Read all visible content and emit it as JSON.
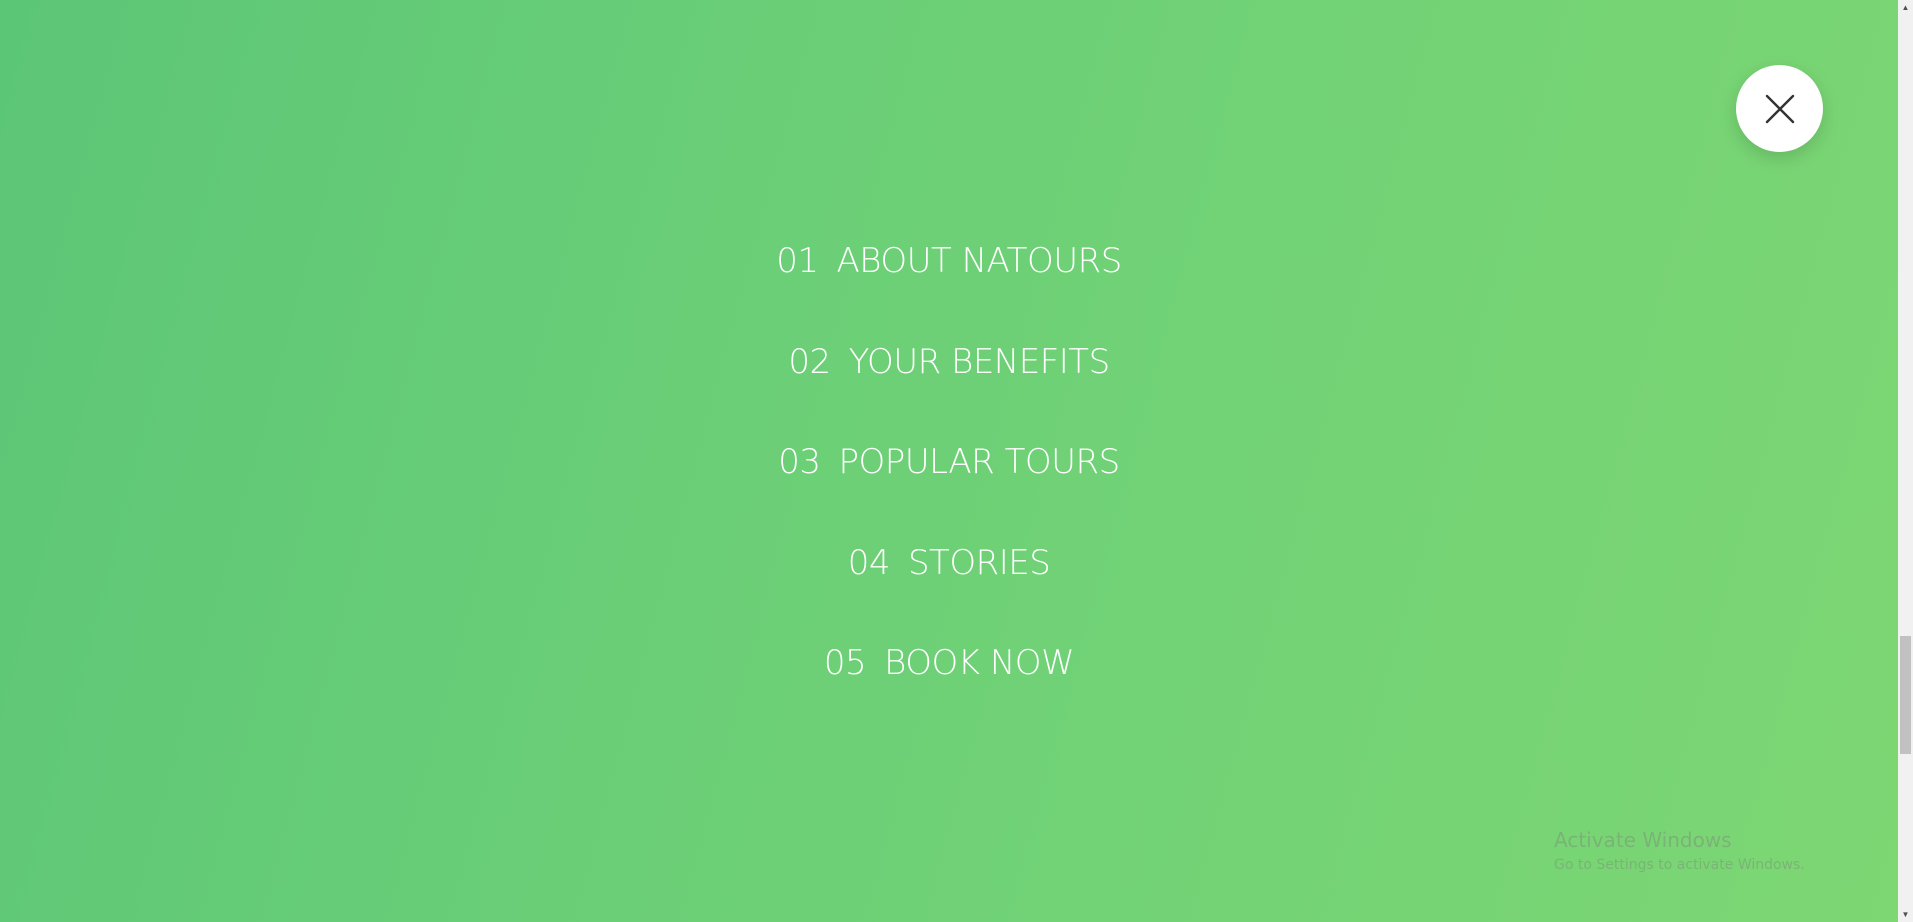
{
  "close_button": {
    "icon": "close-icon"
  },
  "navigation": {
    "items": [
      {
        "number": "01",
        "label": "ABOUT NATOURS"
      },
      {
        "number": "02",
        "label": "YOUR BENEFITS"
      },
      {
        "number": "03",
        "label": "POPULAR TOURS"
      },
      {
        "number": "04",
        "label": "STORIES"
      },
      {
        "number": "05",
        "label": "BOOK NOW"
      }
    ]
  },
  "watermark": {
    "title": "Activate Windows",
    "subtitle": "Go to Settings to activate Windows."
  },
  "colors": {
    "gradient_start": "#5cc677",
    "gradient_end": "#7dd773",
    "nav_text": "#ffffff",
    "close_button_bg": "#ffffff",
    "close_icon": "#333333"
  }
}
